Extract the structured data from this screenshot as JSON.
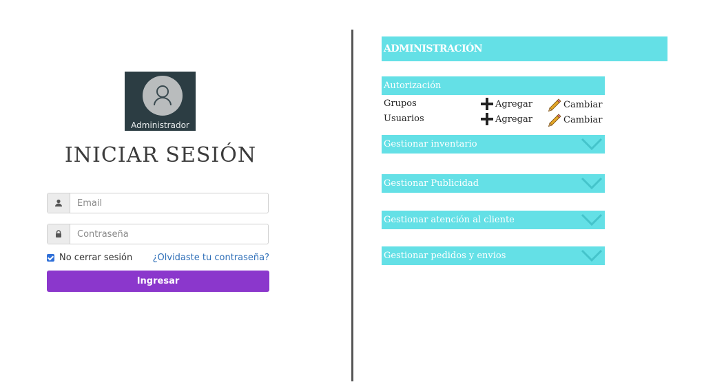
{
  "login": {
    "avatar_label": "Administrador",
    "title": "INICIAR SESIÓN",
    "email_placeholder": "Email",
    "password_placeholder": "Contraseña",
    "remember_label": "No cerrar sesión",
    "remember_checked": true,
    "forgot_link": "¿Olvidaste tu contraseña?",
    "submit_label": "Ingresar",
    "accent_color": "#8b37cc"
  },
  "admin": {
    "header": "ADMINISTRACIÓN",
    "bar_color": "#64e0e6",
    "authorization": {
      "title": "Autorización",
      "rows": [
        {
          "name": "Grupos",
          "add_label": "Agregar",
          "change_label": "Cambiar"
        },
        {
          "name": "Usuarios",
          "add_label": "Agregar",
          "change_label": "Cambiar"
        }
      ]
    },
    "sections": [
      {
        "label": "Gestionar inventario",
        "icon": "chevron-down-icon"
      },
      {
        "label": "Gestionar Publicidad",
        "icon": "chevron-down-icon"
      },
      {
        "label": "Gestionar atención al cliente",
        "icon": "chevron-down-icon"
      },
      {
        "label": "Gestionar pedidos y envios",
        "icon": "chevron-down-icon"
      }
    ]
  }
}
